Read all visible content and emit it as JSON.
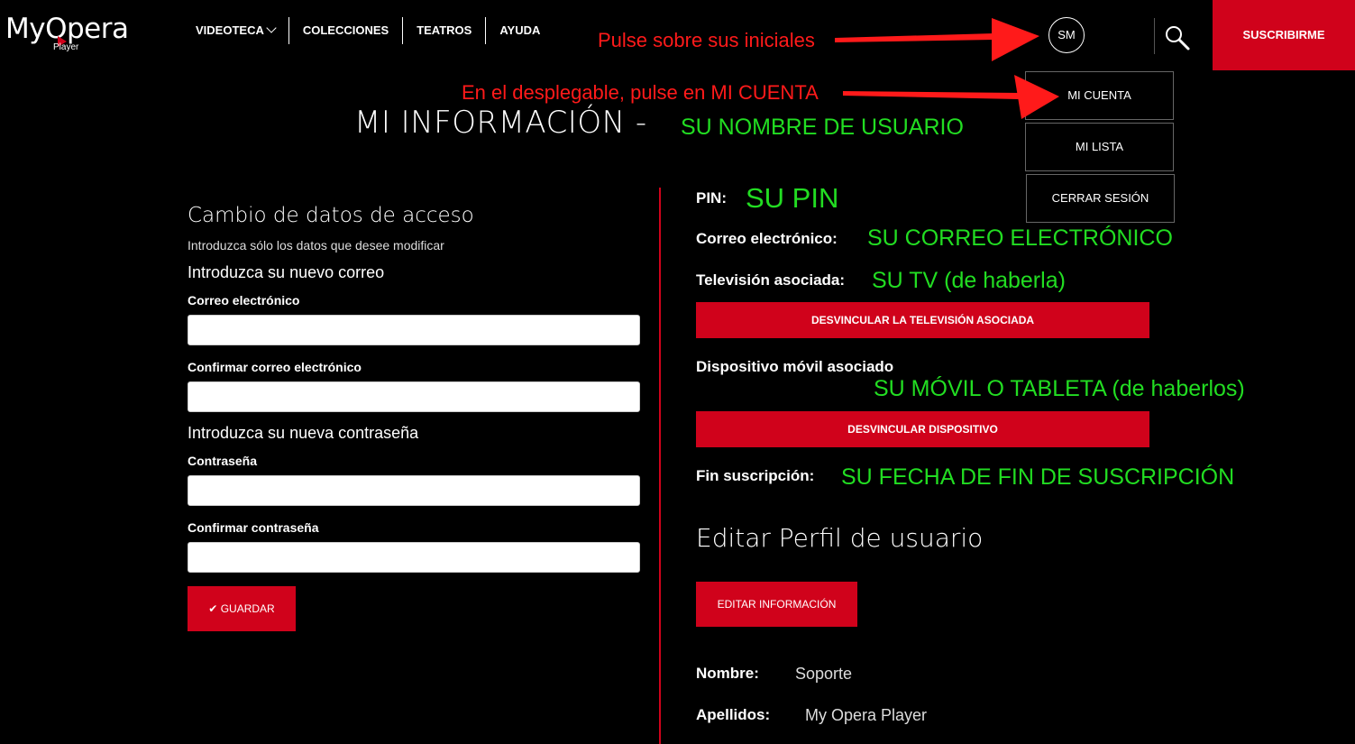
{
  "logo": {
    "word": "MyOpera",
    "sub": "Player"
  },
  "nav": {
    "videoteca": "VIDEOTECA",
    "colecciones": "COLECCIONES",
    "teatros": "TEATROS",
    "ayuda": "AYUDA"
  },
  "header": {
    "avatar_initials": "SM",
    "subscribe_label": "SUSCRIBIRME"
  },
  "dropdown": {
    "mi_cuenta": "MI CUENTA",
    "mi_lista": "MI LISTA",
    "cerrar_sesion": "CERRAR SESIÓN"
  },
  "annotations": {
    "initials_hint": "Pulse sobre sus iniciales",
    "dropdown_hint": "En el desplegable, pulse en MI CUENTA",
    "username": "SU NOMBRE DE USUARIO",
    "pin": "SU PIN",
    "email": "SU CORREO ELECTRÓNICO",
    "tv": "SU TV (de haberla)",
    "mobile": "SU MÓVIL O TABLETA (de haberlos)",
    "end_date": "SU FECHA DE FIN DE SUSCRIPCIÓN",
    "arrow_color": "#ff1a1a"
  },
  "page": {
    "title": "MI INFORMACIÓN -"
  },
  "access_form": {
    "title": "Cambio de datos de acceso",
    "hint": "Introduzca sólo los datos que desee modificar",
    "email_section": "Introduzca su nuevo correo",
    "email_label": "Correo electrónico",
    "email_value": "",
    "email_confirm_label": "Confirmar correo electrónico",
    "email_confirm_value": "",
    "password_section": "Introduzca su nueva contraseña",
    "password_label": "Contraseña",
    "password_value": "",
    "password_confirm_label": "Confirmar contraseña",
    "password_confirm_value": "",
    "save_label": "GUARDAR"
  },
  "account_info": {
    "pin_label": "PIN:",
    "email_label": "Correo electrónico:",
    "tv_label": "Televisión asociada:",
    "unlink_tv_label": "DESVINCULAR LA TELEVISIÓN ASOCIADA",
    "mobile_label": "Dispositivo móvil asociado",
    "unlink_device_label": "DESVINCULAR DISPOSITIVO",
    "end_label": "Fin suscripción:"
  },
  "profile": {
    "title": "Editar Perfil de usuario",
    "edit_label": "EDITAR INFORMACIÓN",
    "first_name_label": "Nombre:",
    "first_name_value": "Soporte",
    "last_name_label": "Apellidos:",
    "last_name_value": "My Opera Player"
  },
  "colors": {
    "accent": "#d0021b",
    "background": "#000000",
    "annotation_green": "#22dd22"
  }
}
